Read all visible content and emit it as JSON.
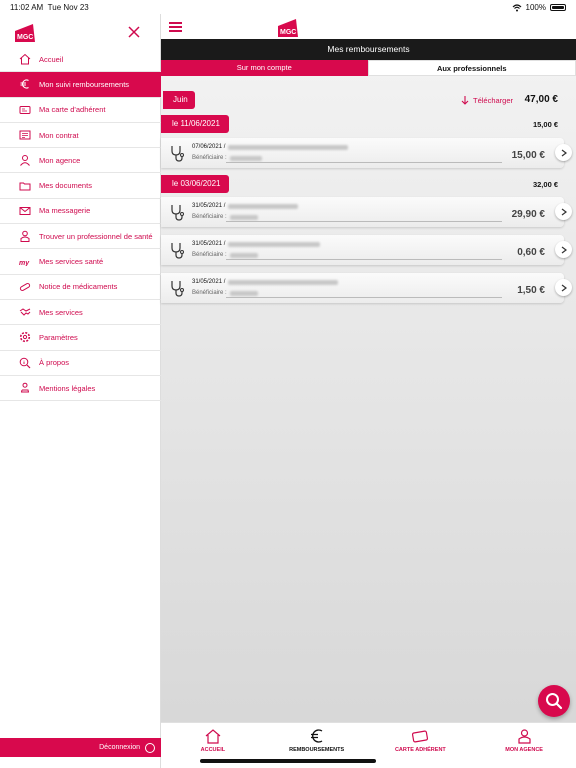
{
  "status": {
    "time": "11:02 AM",
    "date": "Tue Nov 23",
    "battery": "100%"
  },
  "brand": {
    "logo_text": "MGC",
    "accent": "#d8094d"
  },
  "sidebar": {
    "items": [
      {
        "label": "Accueil",
        "icon": "home-icon"
      },
      {
        "label": "Mon suivi remboursements",
        "icon": "euro-icon",
        "active": true
      },
      {
        "label": "Ma carte d'adhérent",
        "icon": "card-icon"
      },
      {
        "label": "Mon contrat",
        "icon": "contract-icon"
      },
      {
        "label": "Mon agence",
        "icon": "agent-icon"
      },
      {
        "label": "Mes documents",
        "icon": "folder-icon"
      },
      {
        "label": "Ma messagerie",
        "icon": "mail-icon"
      },
      {
        "label": "Trouver un professionnel de santé",
        "icon": "doctor-icon"
      },
      {
        "label": "Mes services santé",
        "icon": "services-health-icon"
      },
      {
        "label": "Notice de médicaments",
        "icon": "pill-icon"
      },
      {
        "label": "Mes services",
        "icon": "handshake-icon"
      },
      {
        "label": "Paramètres",
        "icon": "gear-icon"
      },
      {
        "label": "À propos",
        "icon": "info-search-icon"
      },
      {
        "label": "Mentions légales",
        "icon": "legal-icon"
      }
    ],
    "logout_label": "Déconnexion"
  },
  "main": {
    "title": "Mes remboursements",
    "tabs": [
      {
        "label": "Sur mon compte",
        "active": true
      },
      {
        "label": "Aux professionnels",
        "active": false
      }
    ],
    "month": "Juin",
    "download_label": "Télécharger",
    "month_total": "47,00 €",
    "groups": [
      {
        "date": "le 11/06/2021",
        "total": "15,00 €",
        "items": [
          {
            "date": "07/06/2021 /",
            "beneficiary_label": "Bénéficiaire :",
            "amount": "15,00 €"
          }
        ]
      },
      {
        "date": "le 03/06/2021",
        "total": "32,00 €",
        "items": [
          {
            "date": "31/05/2021 /",
            "beneficiary_label": "Bénéficiaire :",
            "amount": "29,90 €"
          },
          {
            "date": "31/05/2021 /",
            "beneficiary_label": "Bénéficiaire :",
            "amount": "0,60 €"
          },
          {
            "date": "31/05/2021 /",
            "beneficiary_label": "Bénéficiaire :",
            "amount": "1,50 €"
          }
        ]
      }
    ]
  },
  "bottom_nav": [
    {
      "label": "ACCUEIL",
      "icon": "home-icon"
    },
    {
      "label": "REMBOURSEMENTS",
      "icon": "euro-icon",
      "active": true
    },
    {
      "label": "CARTE ADHÉRENT",
      "icon": "card-icon"
    },
    {
      "label": "MON AGENCE",
      "icon": "agent-icon"
    }
  ]
}
